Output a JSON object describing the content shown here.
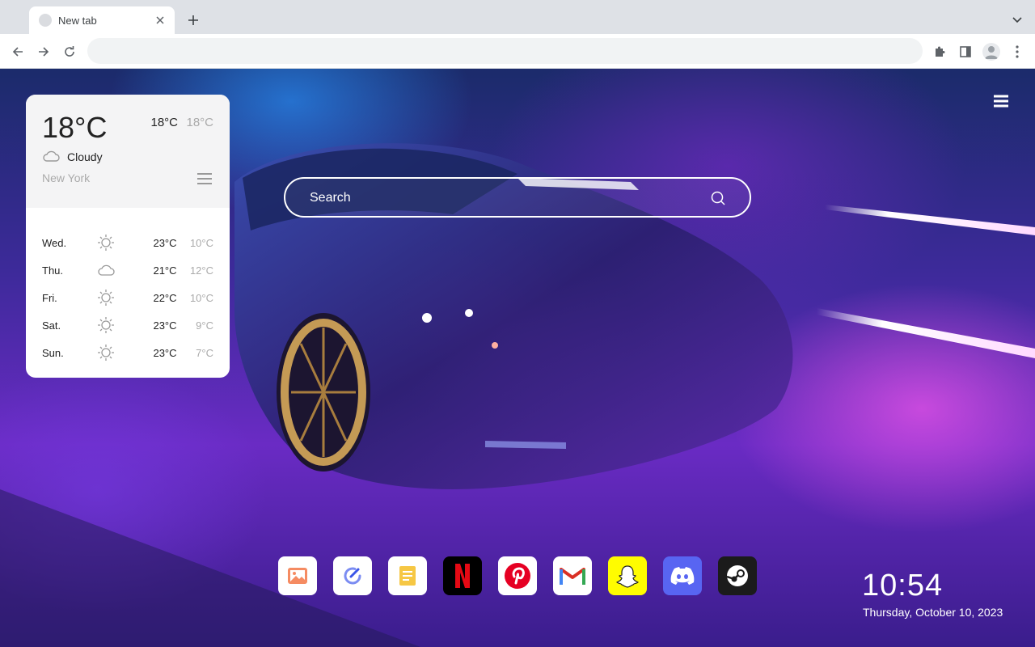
{
  "browser": {
    "tab_title": "New tab",
    "omnibox_value": ""
  },
  "weather": {
    "temp_main": "18°C",
    "temp_high": "18°C",
    "temp_low": "18°C",
    "condition": "Cloudy",
    "condition_icon": "cloud-icon",
    "city": "New York",
    "forecast": [
      {
        "day": "Wed.",
        "icon": "sun-icon",
        "high": "23°C",
        "low": "10°C"
      },
      {
        "day": "Thu.",
        "icon": "cloud-icon",
        "high": "21°C",
        "low": "12°C"
      },
      {
        "day": "Fri.",
        "icon": "sun-icon",
        "high": "22°C",
        "low": "10°C"
      },
      {
        "day": "Sat.",
        "icon": "sun-icon",
        "high": "23°C",
        "low": "9°C"
      },
      {
        "day": "Sun.",
        "icon": "sun-icon",
        "high": "23°C",
        "low": "7°C"
      }
    ]
  },
  "search": {
    "placeholder": "Search"
  },
  "dock": {
    "apps": [
      {
        "name": "Photos",
        "icon": "photos-icon",
        "color": "#ffffff"
      },
      {
        "name": "Tasks",
        "icon": "tasks-icon",
        "color": "#ffffff"
      },
      {
        "name": "Notes",
        "icon": "notes-icon",
        "color": "#ffffff"
      },
      {
        "name": "Netflix",
        "icon": "netflix-icon",
        "color": "#000000"
      },
      {
        "name": "Pinterest",
        "icon": "pinterest-icon",
        "color": "#ffffff"
      },
      {
        "name": "Gmail",
        "icon": "gmail-icon",
        "color": "#ffffff"
      },
      {
        "name": "Snapchat",
        "icon": "snapchat-icon",
        "color": "#fffc00"
      },
      {
        "name": "Discord",
        "icon": "discord-icon",
        "color": "#5865f2"
      },
      {
        "name": "Steam",
        "icon": "steam-icon",
        "color": "#1b1b1b"
      }
    ]
  },
  "clock": {
    "time": "10:54",
    "date": "Thursday, October 10, 2023"
  }
}
